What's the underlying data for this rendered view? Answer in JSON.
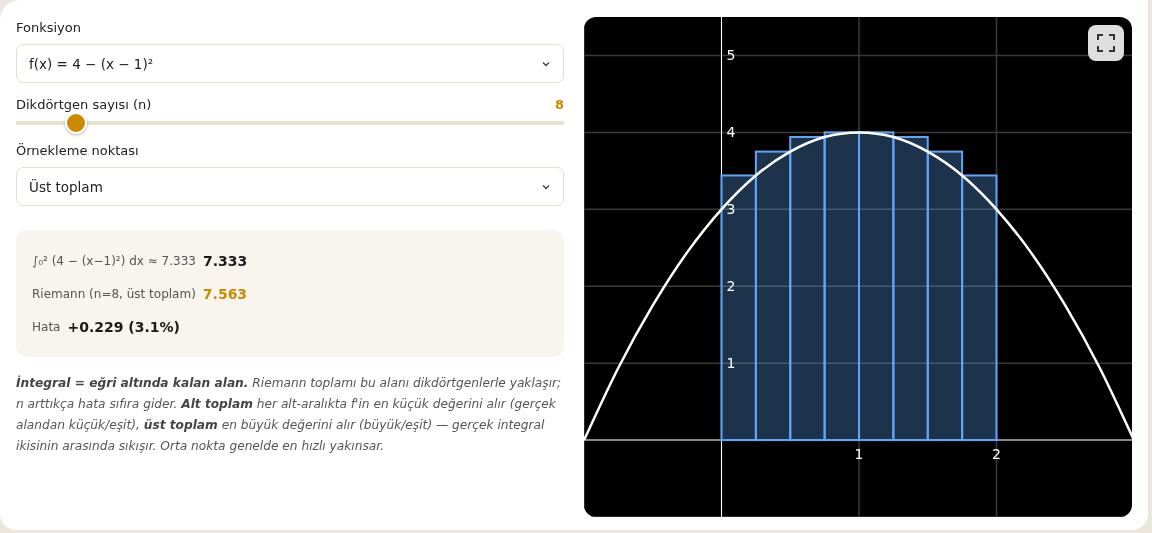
{
  "function_select": {
    "label": "Fonksiyon",
    "value": "f(x) = 4 − (x − 1)²"
  },
  "rect_slider": {
    "label": "Dikdörtgen sayısı (n)",
    "reading": "8",
    "level": 0.11
  },
  "sample_select": {
    "label": "Örnekleme noktası",
    "value": "Üst toplam"
  },
  "results": [
    {
      "label": "∫₀² (4 − (x−1)²) dx ≈ 7.333",
      "value": "7.333",
      "color": "#1a1a1a"
    },
    {
      "label": "Riemann (n=8, üst toplam)",
      "value": "7.563",
      "color": "#cc8a00"
    },
    {
      "label": "Hata",
      "value": "+0.229 (3.1%)",
      "color": "#1a1a1a"
    }
  ],
  "description": "**İntegral = eğri altında kalan alan.** Riemann toplamı bu alanı dikdörtgenlerle yaklaşır; n arttıkça hata sıfıra gider. **Alt toplam** her alt-aralıkta f'in en küçük değerini alır (gerçek alandan küçük/eşit), **üst toplam** en büyük değerini alır (büyük/eşit) — gerçek integral ikisinin arasında sıkışır. Orta nokta genelde en hızlı yakınsar.",
  "chart": {
    "chart_data": {
      "type": "bar",
      "xlim": [
        -1,
        3
      ],
      "ylim": [
        -1,
        5.5
      ],
      "xticks": [
        1,
        2
      ],
      "grid": true,
      "yticks": [
        1,
        2,
        3,
        4,
        5
      ],
      "series": [
        {
          "type": "bar",
          "color": "#60a5fa",
          "x": [
            0.125,
            0.375,
            0.625,
            0.875,
            1.125,
            1.375,
            1.625,
            1.875
          ],
          "values": [
            3.44,
            3.75,
            3.94,
            4,
            4,
            3.94,
            3.75,
            3.44
          ]
        },
        {
          "type": "line",
          "color": "#ffffff",
          "x": [
            -1,
            -0.75,
            -0.5,
            -0.25,
            0,
            0.25,
            0.5,
            0.75,
            1,
            1.25,
            1.5,
            1.75,
            2,
            2.25,
            2.5,
            2.75,
            3
          ],
          "values": [
            0,
            0.94,
            1.75,
            2.44,
            3,
            3.44,
            3.75,
            3.94,
            4,
            3.94,
            3.75,
            3.44,
            3,
            2.44,
            1.75,
            0.94,
            0
          ]
        }
      ]
    }
  }
}
